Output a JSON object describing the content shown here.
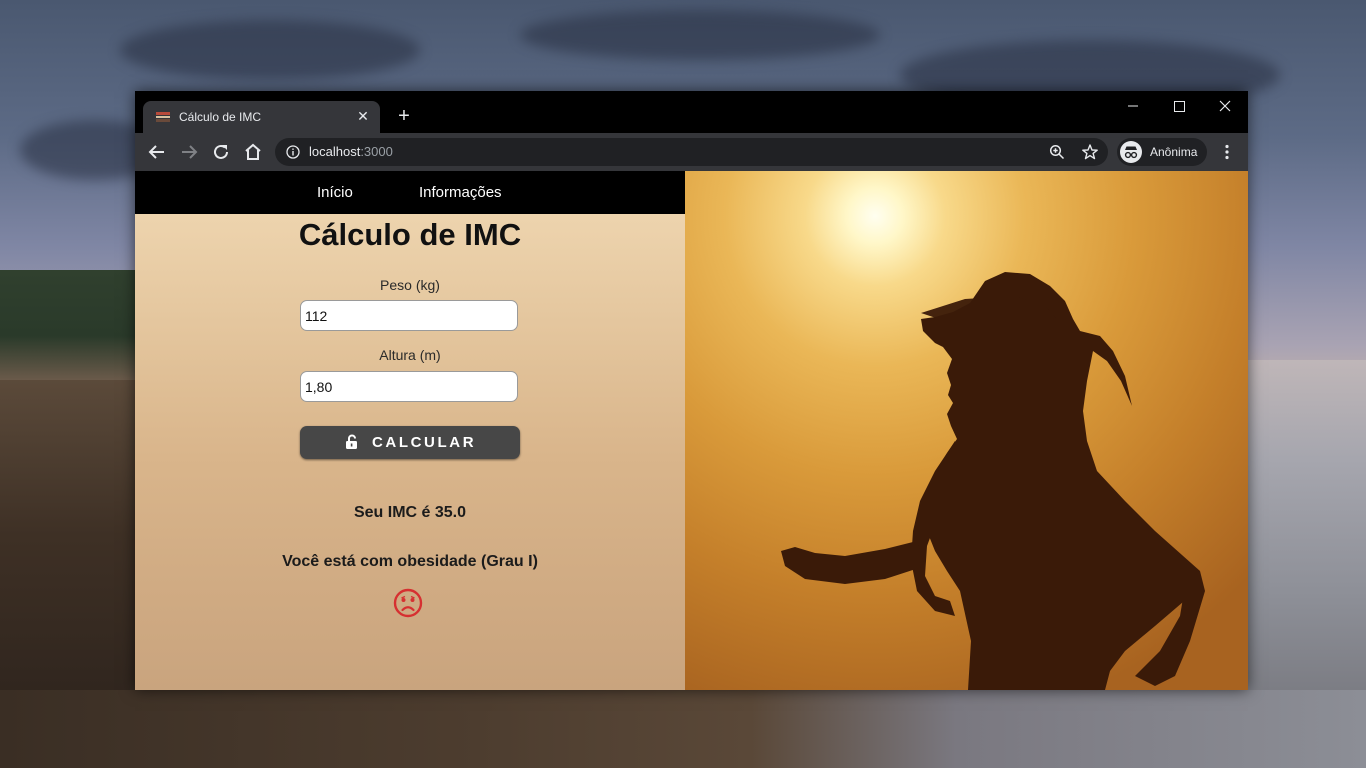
{
  "browser": {
    "tab_title": "Cálculo de IMC",
    "new_tab_symbol": "+",
    "url_host": "localhost",
    "url_port": ":3000",
    "profile_label": "Anônima"
  },
  "nav": {
    "items": [
      {
        "label": "Início"
      },
      {
        "label": "Informações"
      }
    ]
  },
  "page": {
    "title": "Cálculo de IMC",
    "peso_label": "Peso (kg)",
    "peso_value": "112",
    "altura_label": "Altura (m)",
    "altura_value": "1,80",
    "calc_button": "CALCULAR",
    "result_imc": "Seu IMC é 35.0",
    "result_status": "Você está com obesidade (Grau I)"
  },
  "icons": {
    "calc_button_icon": "lock-open-icon",
    "result_icon": "sad-face-icon",
    "result_icon_color": "#d63031"
  },
  "colors": {
    "navbar": "#000000",
    "button": "#474747",
    "browser_toolbar": "#35363a"
  }
}
